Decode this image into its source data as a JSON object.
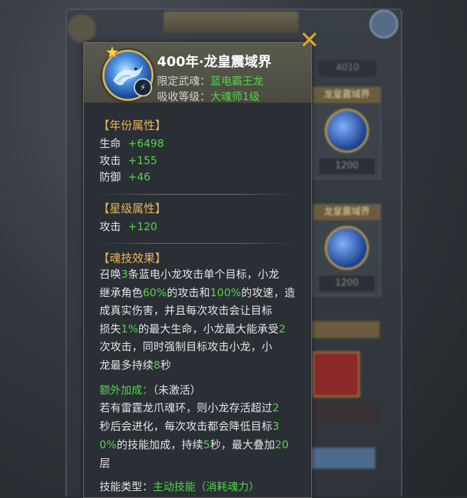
{
  "background": {
    "title": "",
    "pill_value": "4010",
    "cards": [
      {
        "header": "龙皇震域界",
        "cost": "1200"
      },
      {
        "header": "龙皇震域界",
        "cost": "1200"
      }
    ]
  },
  "tooltip": {
    "title": "400年·龙皇震域界",
    "limit_label": "限定武魂：",
    "limit_value": "蓝电霸王龙",
    "level_label": "吸收等级：",
    "level_value": "大魂师1级",
    "icon": "dragon-soul-ring-icon",
    "star_icon": "star-icon",
    "type_icon": "lightning-type-icon",
    "close_icon": "close-icon"
  },
  "year_attrs": {
    "title": "【年份属性】",
    "stats": [
      {
        "name": "生命",
        "value": "+6498"
      },
      {
        "name": "攻击",
        "value": "+155"
      },
      {
        "name": "防御",
        "value": "+46"
      }
    ]
  },
  "star_attrs": {
    "title": "【星级属性】",
    "stats": [
      {
        "name": "攻击",
        "value": "+120"
      }
    ]
  },
  "skill": {
    "title": "【魂技效果】",
    "lines": [
      [
        {
          "t": "召唤"
        },
        {
          "t": "3",
          "g": true
        },
        {
          "t": "条蓝电小龙攻击单个目标，小龙"
        }
      ],
      [
        {
          "t": "继承角色"
        },
        {
          "t": "60%",
          "g": true
        },
        {
          "t": "的攻击和"
        },
        {
          "t": "100%",
          "g": true
        },
        {
          "t": "的攻速，造"
        }
      ],
      [
        {
          "t": "成真实伤害，并且每次攻击会让目标"
        }
      ],
      [
        {
          "t": "损失"
        },
        {
          "t": "1%",
          "g": true
        },
        {
          "t": "的最大生命，小龙最大能承受"
        },
        {
          "t": "2",
          "g": true
        }
      ],
      [
        {
          "t": "次攻击，同时强制目标攻击小龙，小"
        }
      ],
      [
        {
          "t": "龙最多持续"
        },
        {
          "t": "8",
          "g": true
        },
        {
          "t": "秒"
        }
      ]
    ],
    "bonus_label": "额外加成：",
    "bonus_status": "（未激活）",
    "bonus_lines": [
      [
        {
          "t": "若有雷霆龙爪魂环，则小龙存活超过"
        },
        {
          "t": "2",
          "g": true
        }
      ],
      [
        {
          "t": "秒后会进化，每次攻击都会降低目标"
        },
        {
          "t": "3",
          "g": true
        }
      ],
      [
        {
          "t": "0%",
          "g": true
        },
        {
          "t": "的技能加成，持续"
        },
        {
          "t": "5",
          "g": true
        },
        {
          "t": "秒，最大叠加"
        },
        {
          "t": "20",
          "g": true
        }
      ],
      [
        {
          "t": "层"
        }
      ]
    ],
    "type_label": "技能类型：",
    "type_value": "主动技能（消耗魂力）"
  },
  "colors": {
    "green": "#54d44a",
    "gold": "#e8b455",
    "panel": "#2a2f35"
  }
}
